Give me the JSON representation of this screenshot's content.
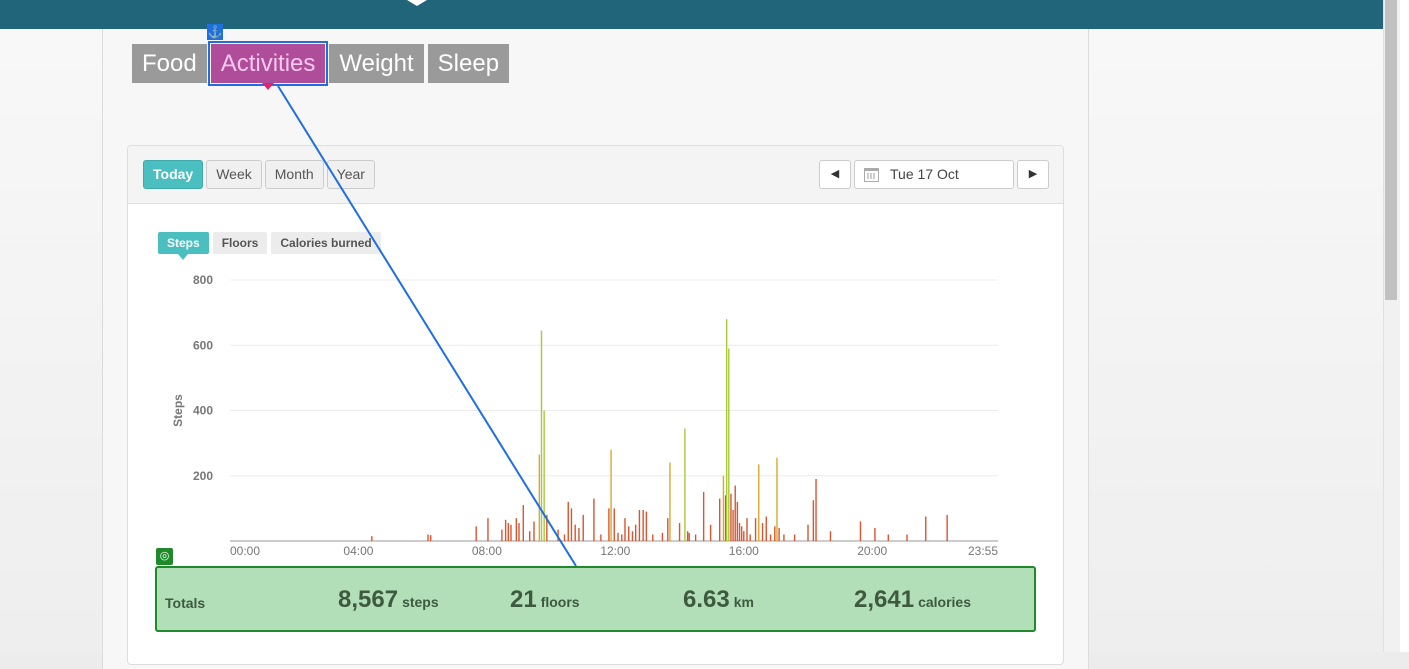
{
  "main_tabs": [
    {
      "label": "Food"
    },
    {
      "label": "Activities"
    },
    {
      "label": "Weight"
    },
    {
      "label": "Sleep"
    }
  ],
  "anchor_icon": "anchor-icon",
  "range": {
    "buttons": [
      "Today",
      "Week",
      "Month",
      "Year"
    ],
    "active": "Today"
  },
  "date_nav": {
    "date": "Tue 17 Oct",
    "prev_icon": "caret-left-icon",
    "next_icon": "caret-right-icon",
    "calendar_icon": "calendar-icon"
  },
  "metric_tabs": {
    "items": [
      "Steps",
      "Floors",
      "Calories burned"
    ],
    "active": "Steps"
  },
  "chart_data": {
    "type": "bar",
    "ylabel": "Steps",
    "ylim": [
      0,
      800
    ],
    "y_ticks": [
      "800",
      "600",
      "400",
      "200"
    ],
    "x_ticks": [
      "00:00",
      "04:00",
      "08:00",
      "12:00",
      "16:00",
      "20:00",
      "23:55"
    ],
    "x_range_minutes": [
      0,
      1435
    ],
    "grid": true,
    "bars": [
      {
        "x": 265,
        "y": 15
      },
      {
        "x": 370,
        "y": 20
      },
      {
        "x": 375,
        "y": 18
      },
      {
        "x": 460,
        "y": 45
      },
      {
        "x": 482,
        "y": 70
      },
      {
        "x": 508,
        "y": 35
      },
      {
        "x": 515,
        "y": 65
      },
      {
        "x": 520,
        "y": 55
      },
      {
        "x": 525,
        "y": 50
      },
      {
        "x": 535,
        "y": 70
      },
      {
        "x": 540,
        "y": 55
      },
      {
        "x": 548,
        "y": 110
      },
      {
        "x": 560,
        "y": 30
      },
      {
        "x": 568,
        "y": 60
      },
      {
        "x": 578,
        "y": 265
      },
      {
        "x": 582,
        "y": 645
      },
      {
        "x": 587,
        "y": 400
      },
      {
        "x": 592,
        "y": 80
      },
      {
        "x": 613,
        "y": 35
      },
      {
        "x": 625,
        "y": 20
      },
      {
        "x": 632,
        "y": 120
      },
      {
        "x": 638,
        "y": 100
      },
      {
        "x": 645,
        "y": 50
      },
      {
        "x": 652,
        "y": 40
      },
      {
        "x": 660,
        "y": 80
      },
      {
        "x": 680,
        "y": 130
      },
      {
        "x": 693,
        "y": 20
      },
      {
        "x": 708,
        "y": 100
      },
      {
        "x": 712,
        "y": 280
      },
      {
        "x": 718,
        "y": 100
      },
      {
        "x": 725,
        "y": 25
      },
      {
        "x": 732,
        "y": 20
      },
      {
        "x": 738,
        "y": 70
      },
      {
        "x": 745,
        "y": 45
      },
      {
        "x": 752,
        "y": 30
      },
      {
        "x": 758,
        "y": 50
      },
      {
        "x": 765,
        "y": 95
      },
      {
        "x": 772,
        "y": 95
      },
      {
        "x": 778,
        "y": 90
      },
      {
        "x": 790,
        "y": 20
      },
      {
        "x": 808,
        "y": 25
      },
      {
        "x": 818,
        "y": 70
      },
      {
        "x": 822,
        "y": 240
      },
      {
        "x": 840,
        "y": 55
      },
      {
        "x": 850,
        "y": 345
      },
      {
        "x": 855,
        "y": 30
      },
      {
        "x": 858,
        "y": 25
      },
      {
        "x": 870,
        "y": 20
      },
      {
        "x": 885,
        "y": 150
      },
      {
        "x": 898,
        "y": 50
      },
      {
        "x": 915,
        "y": 130
      },
      {
        "x": 922,
        "y": 200
      },
      {
        "x": 926,
        "y": 140
      },
      {
        "x": 928,
        "y": 680
      },
      {
        "x": 932,
        "y": 590
      },
      {
        "x": 936,
        "y": 145
      },
      {
        "x": 940,
        "y": 95
      },
      {
        "x": 944,
        "y": 170
      },
      {
        "x": 948,
        "y": 120
      },
      {
        "x": 952,
        "y": 55
      },
      {
        "x": 956,
        "y": 45
      },
      {
        "x": 960,
        "y": 30
      },
      {
        "x": 966,
        "y": 70
      },
      {
        "x": 972,
        "y": 20
      },
      {
        "x": 982,
        "y": 70
      },
      {
        "x": 988,
        "y": 235
      },
      {
        "x": 995,
        "y": 55
      },
      {
        "x": 1002,
        "y": 75
      },
      {
        "x": 1010,
        "y": 20
      },
      {
        "x": 1018,
        "y": 45
      },
      {
        "x": 1022,
        "y": 255
      },
      {
        "x": 1026,
        "y": 40
      },
      {
        "x": 1035,
        "y": 20
      },
      {
        "x": 1055,
        "y": 20
      },
      {
        "x": 1080,
        "y": 50
      },
      {
        "x": 1090,
        "y": 125
      },
      {
        "x": 1095,
        "y": 190
      },
      {
        "x": 1122,
        "y": 30
      },
      {
        "x": 1178,
        "y": 60
      },
      {
        "x": 1205,
        "y": 40
      },
      {
        "x": 1230,
        "y": 20
      },
      {
        "x": 1265,
        "y": 20
      },
      {
        "x": 1300,
        "y": 75
      },
      {
        "x": 1340,
        "y": 80
      }
    ],
    "colors": {
      "high": "#a8c93a",
      "mid": "#d9a830",
      "low": "#d9552f"
    }
  },
  "totals": {
    "label": "Totals",
    "items": [
      {
        "num": "8,567",
        "unit": "steps"
      },
      {
        "num": "21",
        "unit": "floors"
      },
      {
        "num": "6.63",
        "unit": "km"
      },
      {
        "num": "2,641",
        "unit": "calories"
      }
    ],
    "icon": "target-icon"
  },
  "colors": {
    "topbar": "#21657a",
    "accent": "#4bbfbf",
    "activities": "#b04d9a",
    "annotation": "#1f6fe0",
    "totals_border": "#1e8a2a"
  }
}
